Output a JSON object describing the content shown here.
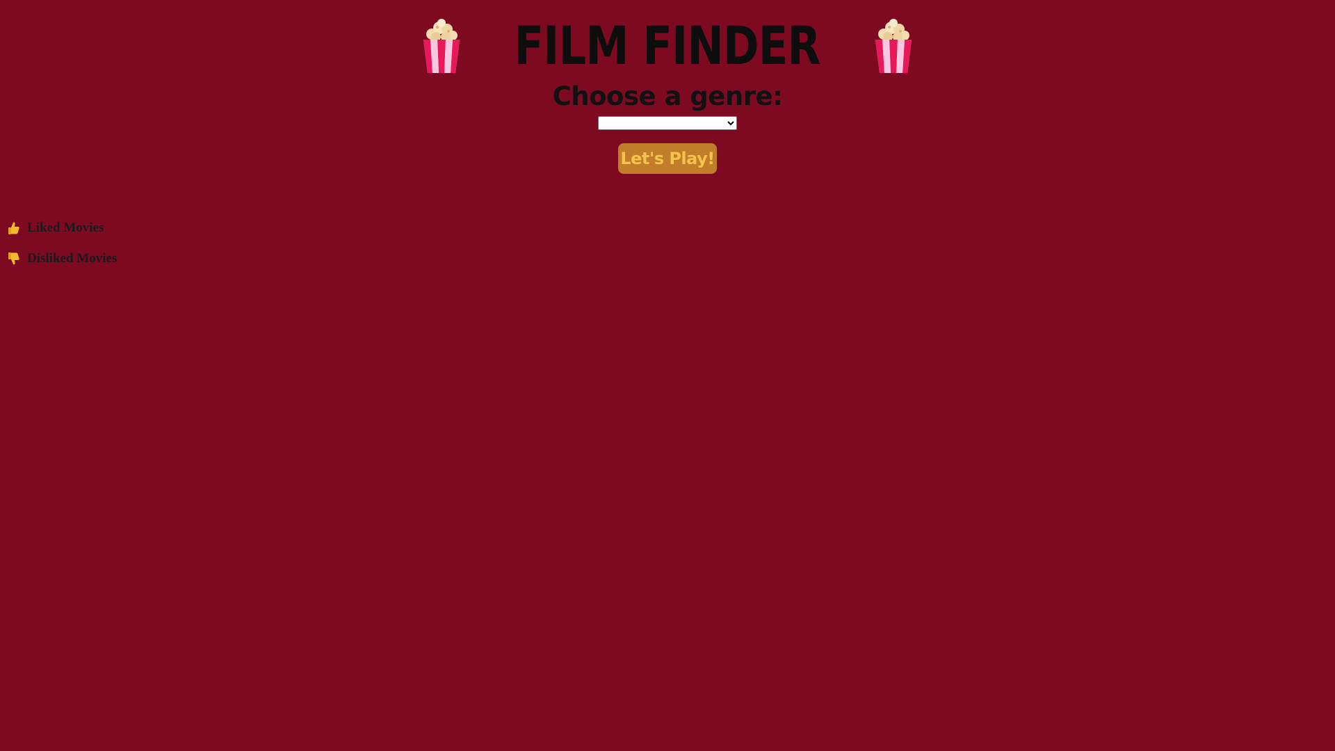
{
  "header": {
    "title": "FILM FINDER",
    "left_icon": "popcorn-icon",
    "right_icon": "popcorn-icon"
  },
  "genre_prompt": "Choose a genre:",
  "genre_select": {
    "selected": "",
    "options": [
      ""
    ]
  },
  "play_button": {
    "label": "Let's Play!"
  },
  "lists": {
    "liked": {
      "icon": "thumbs-up-icon",
      "label": "Liked Movies"
    },
    "disliked": {
      "icon": "thumbs-down-icon",
      "label": "Disliked Movies"
    }
  },
  "colors": {
    "background": "#7e0a22",
    "button": "#c17d2a",
    "button_text": "#f4c34c",
    "title": "#0d0d0d"
  }
}
